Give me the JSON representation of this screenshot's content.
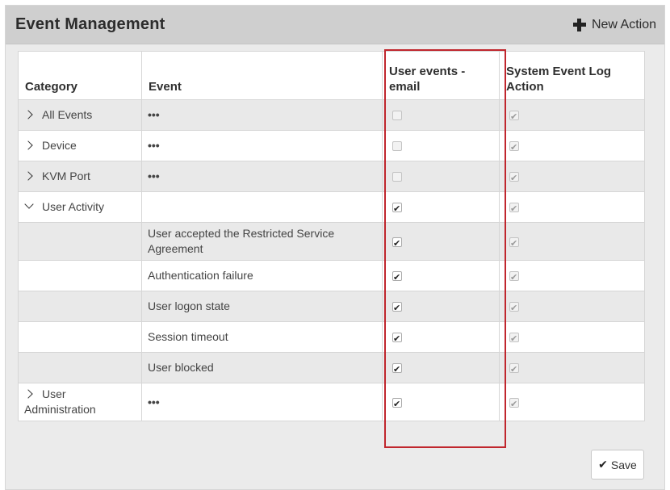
{
  "header": {
    "title": "Event Management",
    "new_action_label": "New Action"
  },
  "table": {
    "columns": [
      "Category",
      "Event",
      "User events - email",
      "System Event Log Action"
    ],
    "rows": [
      {
        "category": "All Events",
        "chevron": "right",
        "event": "•••",
        "email": {
          "checked": false,
          "enabled": false
        },
        "syslog": {
          "checked": true,
          "enabled": false
        }
      },
      {
        "category": "Device",
        "chevron": "right",
        "event": "•••",
        "email": {
          "checked": false,
          "enabled": false
        },
        "syslog": {
          "checked": true,
          "enabled": false
        }
      },
      {
        "category": "KVM Port",
        "chevron": "right",
        "event": "•••",
        "email": {
          "checked": false,
          "enabled": false
        },
        "syslog": {
          "checked": true,
          "enabled": false
        }
      },
      {
        "category": "User Activity",
        "chevron": "down",
        "event": "",
        "email": {
          "checked": true,
          "enabled": true
        },
        "syslog": {
          "checked": true,
          "enabled": false
        }
      },
      {
        "category": "",
        "chevron": "",
        "event": "User accepted the Restricted Service Agreement",
        "email": {
          "checked": true,
          "enabled": true
        },
        "syslog": {
          "checked": true,
          "enabled": false
        }
      },
      {
        "category": "",
        "chevron": "",
        "event": "Authentication failure",
        "email": {
          "checked": true,
          "enabled": true
        },
        "syslog": {
          "checked": true,
          "enabled": false
        }
      },
      {
        "category": "",
        "chevron": "",
        "event": "User logon state",
        "email": {
          "checked": true,
          "enabled": true
        },
        "syslog": {
          "checked": true,
          "enabled": false
        }
      },
      {
        "category": "",
        "chevron": "",
        "event": "Session timeout",
        "email": {
          "checked": true,
          "enabled": true
        },
        "syslog": {
          "checked": true,
          "enabled": false
        }
      },
      {
        "category": "",
        "chevron": "",
        "event": "User blocked",
        "email": {
          "checked": true,
          "enabled": true
        },
        "syslog": {
          "checked": true,
          "enabled": false
        }
      },
      {
        "category": "User Administration",
        "chevron": "right",
        "event": "•••",
        "email": {
          "checked": true,
          "enabled": true
        },
        "syslog": {
          "checked": true,
          "enabled": false
        }
      }
    ]
  },
  "footer": {
    "save_label": "Save"
  },
  "colors": {
    "highlight": "#c0262d",
    "header_bg": "#cfcfcf",
    "row_alt": "#e9e9e9"
  },
  "icons": [
    "plus-icon",
    "chevron-right-icon",
    "chevron-down-icon",
    "checkmark-icon"
  ]
}
